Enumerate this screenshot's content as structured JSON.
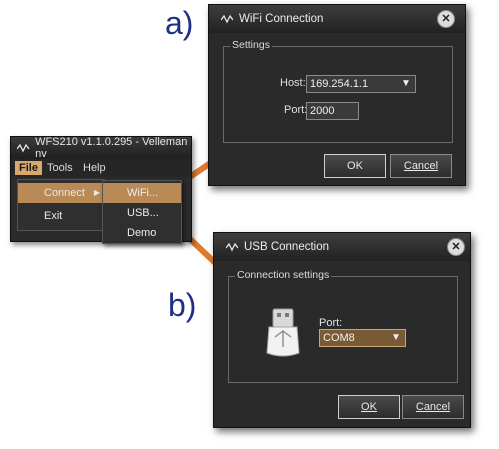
{
  "labels": {
    "a": "a)",
    "b": "b)"
  },
  "app": {
    "title": "WFS210 v1.1.0.295 - Velleman nv",
    "menu": {
      "file": "File",
      "tools": "Tools",
      "help": "Help"
    },
    "file_menu": {
      "connect": "Connect",
      "exit": "Exit"
    },
    "connect_submenu": {
      "wifi": "WiFi...",
      "usb": "USB...",
      "demo": "Demo"
    }
  },
  "wifi_dialog": {
    "title": "WiFi Connection",
    "group_label": "Settings",
    "host_label": "Host:",
    "host_value": "169.254.1.1",
    "port_label": "Port:",
    "port_value": "2000",
    "ok_label": "OK",
    "cancel_label": "Cancel"
  },
  "usb_dialog": {
    "title": "USB Connection",
    "group_label": "Connection settings",
    "port_label": "Port:",
    "port_value": "COM8",
    "ok_label": "OK",
    "cancel_label": "Cancel"
  },
  "colors": {
    "arrow": "#e07a2e",
    "highlight": "#b98a55",
    "label_blue": "#1d2f86"
  },
  "icons": {
    "app_icon": "waveform-icon",
    "submenu_arrow": "chevron-right-icon",
    "close": "close-icon",
    "dropdown": "chevron-down-icon",
    "usb_device": "usb-stick-icon"
  }
}
